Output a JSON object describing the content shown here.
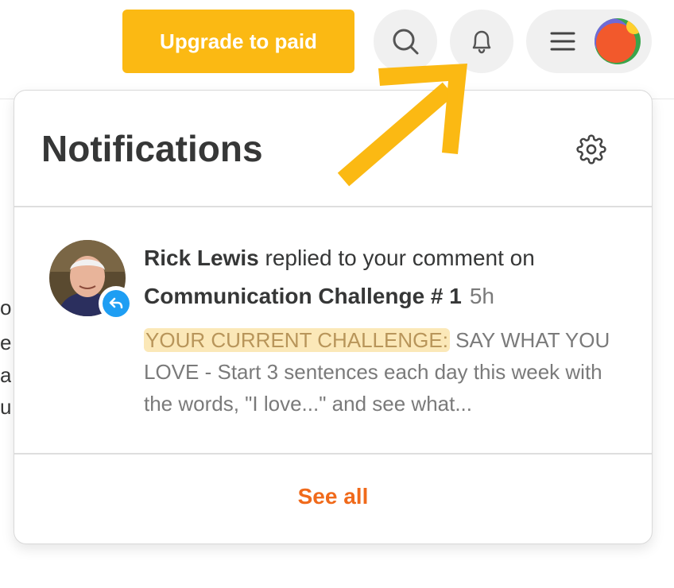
{
  "topbar": {
    "upgrade_label": "Upgrade to paid",
    "icons": [
      "search-icon",
      "bell-icon",
      "menu-icon",
      "user-avatar"
    ],
    "accent_color": "#fbb913"
  },
  "background_text": [
    "o",
    "e",
    "a",
    "u"
  ],
  "notifications": {
    "title": "Notifications",
    "settings_icon": "gear-icon",
    "items": [
      {
        "actor": "Rick Lewis",
        "action": " replied to your comment on",
        "post": "Communication Challenge # 1",
        "time": "5h",
        "highlight": "YOUR CURRENT CHALLENGE:",
        "excerpt": " SAY WHAT YOU LOVE - Start 3 sentences each day this week with the words, \"I love...\" and see what...",
        "badge_icon": "reply-icon",
        "badge_color": "#1e9ef3"
      }
    ],
    "see_all_label": "See all",
    "see_all_color": "#f06a1b"
  }
}
